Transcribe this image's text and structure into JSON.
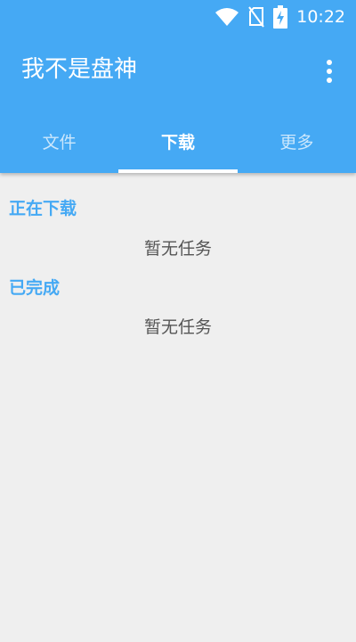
{
  "status_bar": {
    "time": "10:22",
    "icons": [
      "wifi-icon",
      "no-sim-icon",
      "battery-charging-icon"
    ]
  },
  "toolbar": {
    "title": "我不是盘神",
    "menu_icon": "overflow-menu-icon"
  },
  "tabs": [
    {
      "label": "文件",
      "active": false
    },
    {
      "label": "下载",
      "active": true
    },
    {
      "label": "更多",
      "active": false
    }
  ],
  "sections": {
    "downloading": {
      "title": "正在下载",
      "empty_text": "暂无任务"
    },
    "completed": {
      "title": "已完成",
      "empty_text": "暂无任务"
    }
  },
  "colors": {
    "primary": "#45a9f4",
    "background": "#efefef",
    "text_secondary": "#555555"
  }
}
